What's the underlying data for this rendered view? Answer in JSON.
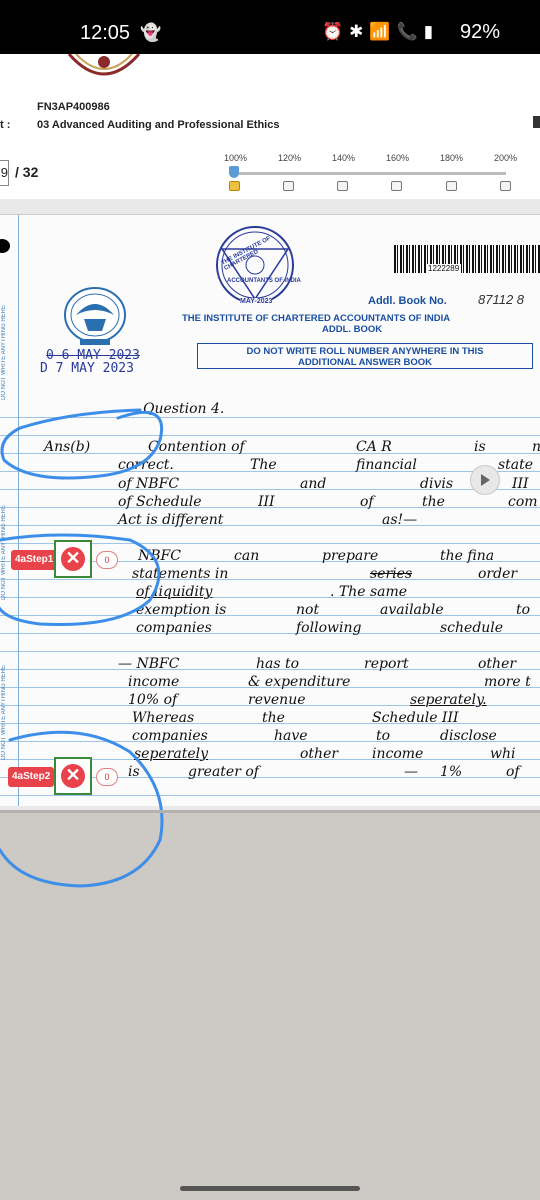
{
  "status_bar": {
    "time": "12:05",
    "icons": "⏰✱📶📞▮",
    "battery": "92%"
  },
  "header": {
    "exam_code": "FN3AP400986",
    "subject_prefix": "t :",
    "subject": "03 Advanced Auditing and Professional Ethics",
    "page_current": "9",
    "page_total": "/ 32"
  },
  "zoom": {
    "levels": [
      "100%",
      "120%",
      "140%",
      "160%",
      "180%",
      "200%"
    ],
    "selected": "100%"
  },
  "sheet": {
    "margin_text": "DO NOT WRITE ANYTHING HERE",
    "seal_lines": [
      "THE INSTITUTE OF CHARTERED",
      "ACCOUNTANTS OF INDIA",
      "MAY-2023"
    ],
    "barcode_number": "1222289",
    "addl_book_no_label": "Addl. Book No.",
    "book_number": "87112 8",
    "institute_name": "THE INSTITUTE OF CHARTERED ACCOUNTANTS OF INDIA",
    "addl_book": "ADDL. BOOK",
    "stamp_old": "0 6 MAY 2023",
    "stamp_new": "D 7 MAY 2023",
    "warning_line1": "DO NOT WRITE ROLL NUMBER ANYWHERE IN THIS",
    "warning_line2": "ADDITIONAL ANSWER BOOK"
  },
  "handwriting": [
    "Question 4.",
    "Ans(b)",
    "Contention of",
    "CA R",
    "is",
    "n",
    "correct.",
    "The",
    "financial",
    "state",
    "of NBFC",
    "and",
    "divis",
    "III",
    "of Schedule",
    "III",
    "of",
    "the",
    "com",
    "Act is different",
    "as!—",
    "NBFC",
    "can",
    "prepare",
    "the fina",
    "statements in",
    "series",
    "order",
    "of liquidity",
    ". The same",
    "exemption is",
    "not",
    "available",
    "to",
    "companies",
    "following",
    "schedule",
    "— NBFC",
    "has to",
    "report",
    "other",
    "income",
    "& expenditure",
    "more t",
    "10% of",
    "revenue",
    "seperately.",
    "Whereas",
    "the",
    "Schedule III",
    "companies",
    "have",
    "to",
    "disclose",
    "seperately",
    "other",
    "income",
    "whi",
    "is",
    "greater of",
    "—",
    "1%",
    "of"
  ],
  "steps": [
    {
      "label": "4aStep1",
      "score": "0"
    },
    {
      "label": "4aStep2",
      "score": "0"
    }
  ],
  "colors": {
    "annotation_blue": "#3d8ee8",
    "step_red": "#e8424a",
    "step_green": "#3a8a3a",
    "print_blue": "#1a4fa0"
  }
}
